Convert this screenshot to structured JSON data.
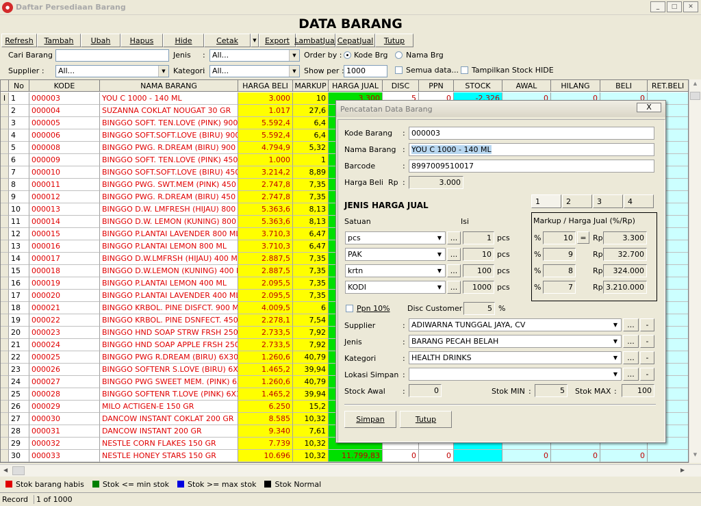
{
  "window": {
    "title": "Daftar Persediaan Barang",
    "icon": "app-icon"
  },
  "heading": "DATA BARANG",
  "toolbar": [
    "Refresh",
    "Tambah",
    "Ubah",
    "Hapus",
    "Hide",
    "Cetak",
    "Export",
    "LambatJual",
    "CepatJual",
    "Tutup"
  ],
  "filters": {
    "cari_barang_label": "Cari Barang :",
    "cari_barang_value": "",
    "jenis_label": "Jenis",
    "jenis_value": "All...",
    "order_by_label": "Order by :",
    "order_opt1": "Kode Brg",
    "order_opt2": "Nama Brg",
    "supplier_label": "Supplier :",
    "supplier_value": "All...",
    "kategori_label": "Kategori",
    "kategori_value": "All...",
    "show_per_label": "Show per :",
    "show_per_value": "1000",
    "semua_data": "Semua data...",
    "tampilkan_hide": "Tampilkan Stock HIDE"
  },
  "columns": [
    "No",
    "KODE",
    "NAMA BARANG",
    "HARGA BELI",
    "MARKUP",
    "HARGA JUAL",
    "DISC",
    "PPN",
    "STOCK",
    "AWAL",
    "HILANG",
    "BELI",
    "RET.BELI"
  ],
  "rows": [
    [
      "1",
      "000003",
      "YOU C 1000  - 140 ML",
      "3.000",
      "10",
      "3.300",
      "5",
      "0",
      "-2.326",
      "0",
      "0",
      "0"
    ],
    [
      "2",
      "000004",
      "SUZANNA COKLAT NOUGAT 30 GR",
      "1.017",
      "27,6",
      "",
      "",
      "",
      "",
      "",
      "",
      ""
    ],
    [
      "3",
      "000005",
      "BINGGO SOFT. TEN.LOVE (PINK) 900 ML",
      "5.592,4",
      "6,4",
      "",
      "",
      "",
      "",
      "",
      "",
      ""
    ],
    [
      "4",
      "000006",
      "BINGGO SOFT.SOFT.LOVE (BIRU) 900 ML",
      "5.592,4",
      "6,4",
      "",
      "",
      "",
      "",
      "",
      "",
      ""
    ],
    [
      "5",
      "000008",
      "BINGGO PWG. R.DREAM (BIRU) 900 ML",
      "4.794,9",
      "5,32",
      "",
      "",
      "",
      "",
      "",
      "",
      ""
    ],
    [
      "6",
      "000009",
      "BINGGO SOFT. TEN.LOVE (PINK) 450 ML",
      "1.000",
      "1",
      "",
      "",
      "",
      "",
      "",
      "",
      ""
    ],
    [
      "7",
      "000010",
      "BINGGO SOFT.SOFT.LOVE (BIRU) 450 ML",
      "3.214,2",
      "8,89",
      "",
      "",
      "",
      "",
      "",
      "",
      ""
    ],
    [
      "8",
      "000011",
      "BINGGO PWG. SWT.MEM (PINK) 450 ML",
      "2.747,8",
      "7,35",
      "",
      "",
      "",
      "",
      "",
      "",
      ""
    ],
    [
      "9",
      "000012",
      "BINGGO PWG. R.DREAM (BIRU) 450 ML",
      "2.747,8",
      "7,35",
      "",
      "",
      "",
      "",
      "",
      "",
      ""
    ],
    [
      "10",
      "000013",
      "BINGGO D.W. LMFRESH (HIJAU) 800 ML",
      "5.363,6",
      "8,13",
      "",
      "",
      "",
      "",
      "",
      "",
      ""
    ],
    [
      "11",
      "000014",
      "BINGGO D.W. LEMON (KUNING) 800 ML",
      "5.363,6",
      "8,13",
      "",
      "",
      "",
      "",
      "",
      "",
      ""
    ],
    [
      "12",
      "000015",
      "BINGGO P.LANTAI LAVENDER 800 ML",
      "3.710,3",
      "6,47",
      "",
      "",
      "",
      "",
      "",
      "",
      ""
    ],
    [
      "13",
      "000016",
      "BINGGO P.LANTAI LEMON 800 ML",
      "3.710,3",
      "6,47",
      "",
      "",
      "",
      "",
      "",
      "",
      ""
    ],
    [
      "14",
      "000017",
      "BINGGO D.W.LMFRSH (HIJAU) 400 ML",
      "2.887,5",
      "7,35",
      "",
      "",
      "",
      "",
      "",
      "",
      ""
    ],
    [
      "15",
      "000018",
      "BINGGO D.W.LEMON (KUNING) 400 ML",
      "2.887,5",
      "7,35",
      "",
      "",
      "",
      "",
      "",
      "",
      ""
    ],
    [
      "16",
      "000019",
      "BINGGO P.LANTAI LEMON 400 ML",
      "2.095,5",
      "7,35",
      "",
      "",
      "",
      "",
      "",
      "",
      ""
    ],
    [
      "17",
      "000020",
      "BINGGO P.LANTAI LAVENDER 400 ML",
      "2.095,5",
      "7,35",
      "",
      "",
      "",
      "",
      "",
      "",
      ""
    ],
    [
      "18",
      "000021",
      "BINGGO KRBOL. PINE DISFCT. 900 ML",
      "4.009,5",
      "6",
      "",
      "",
      "",
      "",
      "",
      "",
      ""
    ],
    [
      "19",
      "000022",
      "BINGGO KRBOL. PINE DSNFECT. 450 ML",
      "2.278,1",
      "7,54",
      "",
      "",
      "",
      "",
      "",
      "",
      ""
    ],
    [
      "20",
      "000023",
      "BINGGO HND SOAP STRW FRSH 250 ML",
      "2.733,5",
      "7,92",
      "",
      "",
      "",
      "",
      "",
      "",
      ""
    ],
    [
      "21",
      "000024",
      "BINGGO HND SOAP APPLE FRSH 250 ML",
      "2.733,5",
      "7,92",
      "",
      "",
      "",
      "",
      "",
      "",
      ""
    ],
    [
      "22",
      "000025",
      "BINGGO PWG R.DREAM (BIRU) 6X30 ML",
      "1.260,6",
      "40,79",
      "",
      "",
      "",
      "",
      "",
      "",
      ""
    ],
    [
      "23",
      "000026",
      "BINGGO SOFTENR S.LOVE (BIRU) 6X30ML",
      "1.465,2",
      "39,94",
      "",
      "",
      "",
      "",
      "",
      "",
      ""
    ],
    [
      "24",
      "000027",
      "BINGGO PWG SWEET MEM. (PINK) 6X30M",
      "1.260,6",
      "40,79",
      "",
      "",
      "",
      "",
      "",
      "",
      ""
    ],
    [
      "25",
      "000028",
      "BINGGO SOFTENR T.LOVE (PINK) 6X30ML",
      "1.465,2",
      "39,94",
      "",
      "",
      "",
      "",
      "",
      "",
      ""
    ],
    [
      "26",
      "000029",
      "MILO ACTIGEN-E 150 GR",
      "6.250",
      "15,2",
      "",
      "",
      "",
      "",
      "",
      "",
      ""
    ],
    [
      "27",
      "000030",
      "DANCOW INSTANT COKLAT 200 GR",
      "8.585",
      "10,32",
      "",
      "",
      "",
      "",
      "",
      "",
      ""
    ],
    [
      "28",
      "000031",
      "DANCOW INSTANT 200 GR",
      "9.340",
      "7,61",
      "",
      "",
      "",
      "",
      "",
      "",
      ""
    ],
    [
      "29",
      "000032",
      "NESTLE CORN FLAKES 150 GR",
      "7.739",
      "10,32",
      "",
      "",
      "",
      "",
      "",
      "",
      ""
    ],
    [
      "30",
      "000033",
      "NESTLE HONEY STARS 150 GR",
      "10.696",
      "10,32",
      "11.799,83",
      "0",
      "0",
      "",
      "0",
      "0",
      "0"
    ]
  ],
  "legend": [
    {
      "label": "Stok barang habis",
      "color": "#e00000"
    },
    {
      "label": "Stok <= min stok",
      "color": "#008000"
    },
    {
      "label": "Stok >= max stok",
      "color": "#0000e0"
    },
    {
      "label": "Stok Normal",
      "color": "#000000"
    }
  ],
  "status": {
    "label": "Record",
    "value": "1 of 1000"
  },
  "dialog": {
    "title": "Pencatatan Data Barang",
    "close": "X",
    "kode_label": "Kode Barang",
    "kode_value": "000003",
    "nama_label": "Nama Barang",
    "nama_value": "YOU C 1000  - 140 ML",
    "barcode_label": "Barcode",
    "barcode_value": "8997009510017",
    "harga_beli_label": "Harga Beli",
    "rp": "Rp",
    "harga_beli_value": "3.000",
    "jenis_harga_heading": "JENIS HARGA JUAL",
    "satuan_label": "Satuan",
    "isi_label": "Isi",
    "units": [
      {
        "unit": "pcs",
        "isi": "1",
        "suffix": "pcs"
      },
      {
        "unit": "PAK",
        "isi": "10",
        "suffix": "pcs"
      },
      {
        "unit": "krtn",
        "isi": "100",
        "suffix": "pcs"
      },
      {
        "unit": "KODI",
        "isi": "1000",
        "suffix": "pcs"
      }
    ],
    "tabs": [
      "1",
      "2",
      "3",
      "4"
    ],
    "markup_heading": "Markup / Harga Jual (%/Rp)",
    "pct": "%",
    "markups": [
      {
        "pct": "10",
        "rp": "3.300"
      },
      {
        "pct": "9",
        "rp": "32.700"
      },
      {
        "pct": "8",
        "rp": "324.000"
      },
      {
        "pct": "7",
        "rp": "3.210.000"
      }
    ],
    "eq": "=",
    "ppn_label": "Ppn 10%",
    "disc_label": "Disc Customer :",
    "disc_value": "5",
    "supplier_label": "Supplier",
    "supplier_value": "ADIWARNA TUNGGAL JAYA, CV",
    "jenis_label": "Jenis",
    "jenis_value": "BARANG PECAH BELAH",
    "kategori_label": "Kategori",
    "kategori_value": "HEALTH DRINKS",
    "lokasi_label": "Lokasi Simpan",
    "lokasi_value": "",
    "stock_awal_label": "Stock Awal",
    "stock_awal_value": "0",
    "stok_min_label": "Stok MIN",
    "stok_min_value": "5",
    "stok_max_label": "Stok MAX",
    "stok_max_value": "100",
    "ellipsis": "...",
    "minus": "-",
    "colon": ":",
    "simpan": "Simpan",
    "tutup": "Tutup"
  }
}
